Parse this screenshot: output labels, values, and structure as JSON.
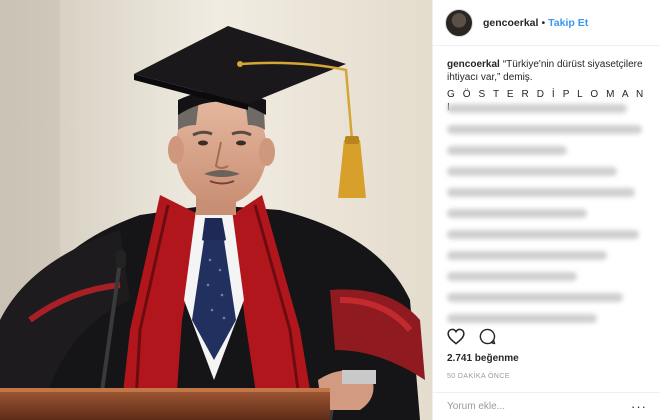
{
  "post": {
    "username": "gencoerkal",
    "follow_label": "Takip Et",
    "separator": "•",
    "caption_user": "gencoerkal",
    "caption_text": "“Türkiye'nin dürüst siyasetçilere ihtiyacı var,” demiş.",
    "caption_spaced": "G Ö S T E R D İ P L O M A N I",
    "likes": "2.741 beğenme",
    "time_ago": "50 DAKİKA ÖNCE",
    "comment_placeholder": "Yorum ekle...",
    "more_icon": "···"
  },
  "icons": {
    "like": "heart-icon",
    "comment": "speech-bubble-icon",
    "more": "ellipsis-icon"
  },
  "colors": {
    "accent": "#3897f0",
    "text": "#262626",
    "muted": "#999999",
    "border": "#efefef"
  }
}
